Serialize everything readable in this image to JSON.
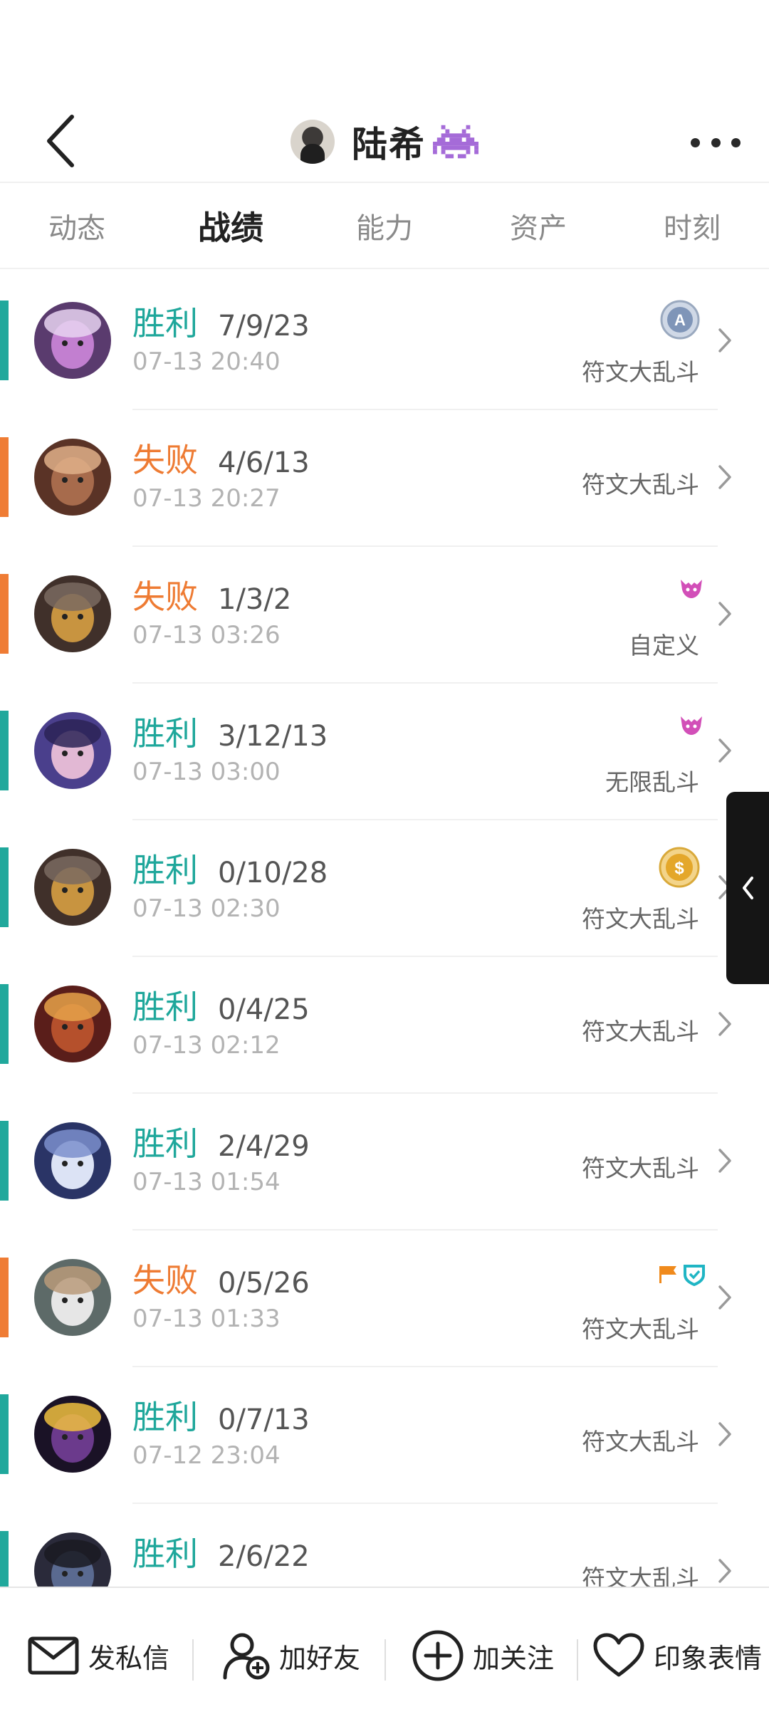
{
  "header": {
    "username": "陆希"
  },
  "tabs": [
    {
      "label": "动态"
    },
    {
      "label": "战绩"
    },
    {
      "label": "能力"
    },
    {
      "label": "资产"
    },
    {
      "label": "时刻"
    }
  ],
  "active_tab": "战绩",
  "matches": [
    {
      "result": "胜利",
      "kda": "7/9/23",
      "time": "07-13 20:40",
      "mode": "符文大乱斗",
      "badge": "rank-a-icon",
      "outcome": "win"
    },
    {
      "result": "失败",
      "kda": "4/6/13",
      "time": "07-13 20:27",
      "mode": "符文大乱斗",
      "badge": "",
      "outcome": "loss"
    },
    {
      "result": "失败",
      "kda": "1/3/2",
      "time": "07-13 03:26",
      "mode": "自定义",
      "badge": "demon-icon",
      "outcome": "loss"
    },
    {
      "result": "胜利",
      "kda": "3/12/13",
      "time": "07-13 03:00",
      "mode": "无限乱斗",
      "badge": "demon-icon",
      "outcome": "win"
    },
    {
      "result": "胜利",
      "kda": "0/10/28",
      "time": "07-13 02:30",
      "mode": "符文大乱斗",
      "badge": "gold-coin-icon",
      "outcome": "win"
    },
    {
      "result": "胜利",
      "kda": "0/4/25",
      "time": "07-13 02:12",
      "mode": "符文大乱斗",
      "badge": "",
      "outcome": "win"
    },
    {
      "result": "胜利",
      "kda": "2/4/29",
      "time": "07-13 01:54",
      "mode": "符文大乱斗",
      "badge": "",
      "outcome": "win"
    },
    {
      "result": "失败",
      "kda": "0/5/26",
      "time": "07-13 01:33",
      "mode": "符文大乱斗",
      "badge": "flag-shield-icon",
      "outcome": "loss"
    },
    {
      "result": "胜利",
      "kda": "0/7/13",
      "time": "07-12 23:04",
      "mode": "符文大乱斗",
      "badge": "",
      "outcome": "win"
    },
    {
      "result": "胜利",
      "kda": "2/6/22",
      "time": "",
      "mode": "符文大乱斗",
      "badge": "",
      "outcome": "win"
    }
  ],
  "bottom_bar": {
    "message": "发私信",
    "add_friend": "加好友",
    "follow": "加关注",
    "impression": "印象表情"
  },
  "colors": {
    "win": "#1fa79b",
    "loss": "#ee7b33"
  }
}
